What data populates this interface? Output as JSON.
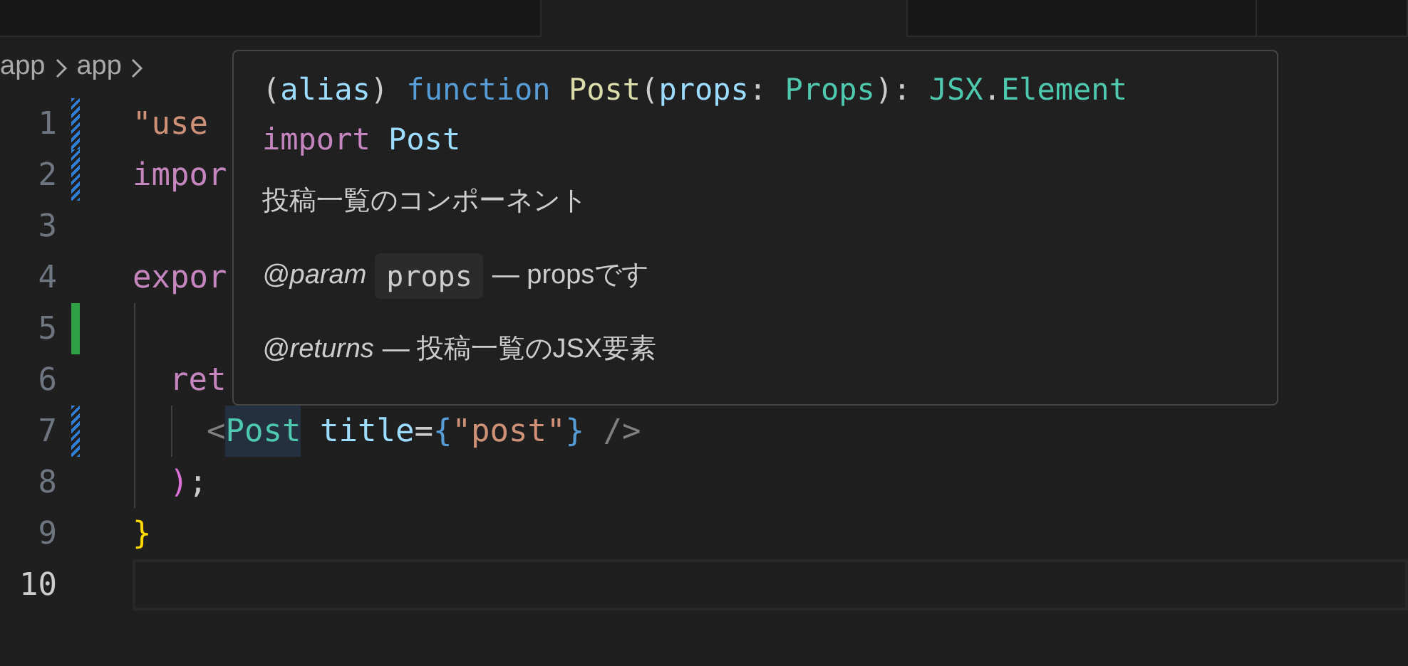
{
  "tabs": [
    {
      "selected": false
    },
    {
      "selected": true
    },
    {
      "selected": false
    },
    {
      "selected": false
    }
  ],
  "breadcrumbs": [
    "app",
    "app"
  ],
  "lines": [
    {
      "number": "1",
      "modified": true,
      "tokens": [
        {
          "text": "\"use",
          "kind": "string"
        }
      ]
    },
    {
      "number": "2",
      "modified": true,
      "tokens": [
        {
          "text": "impor",
          "kind": "keyword"
        }
      ]
    },
    {
      "number": "3"
    },
    {
      "number": "4",
      "tokens": [
        {
          "text": "expor",
          "kind": "keyword"
        }
      ]
    },
    {
      "number": "5",
      "added": true
    },
    {
      "number": "6",
      "tokens": [
        {
          "text": "ret",
          "kind": "keyword"
        }
      ]
    },
    {
      "number": "7",
      "modified": true,
      "tokens": [
        {
          "text": "<",
          "kind": "tag"
        },
        {
          "text": "Post",
          "kind": "component",
          "highlighted": true
        },
        {
          "text": " title",
          "kind": "attribute"
        },
        {
          "text": "=",
          "kind": "plain"
        },
        {
          "text": "{",
          "kind": "brace"
        },
        {
          "text": "\"post\"",
          "kind": "string"
        },
        {
          "text": "}",
          "kind": "brace"
        },
        {
          "text": " />",
          "kind": "tag"
        }
      ]
    },
    {
      "number": "8",
      "tokens": [
        {
          "text": ")",
          "kind": "paren"
        },
        {
          "text": ";",
          "kind": "plain"
        }
      ]
    },
    {
      "number": "9",
      "tokens": [
        {
          "text": "}",
          "kind": "bracket"
        }
      ]
    },
    {
      "number": "10",
      "current": true
    }
  ],
  "hover": {
    "signature": [
      {
        "text": "(",
        "kind": "plain"
      },
      {
        "text": "alias",
        "kind": "variable"
      },
      {
        "text": ") ",
        "kind": "plain"
      },
      {
        "text": "function ",
        "kind": "storage"
      },
      {
        "text": "Post",
        "kind": "function"
      },
      {
        "text": "(",
        "kind": "plain"
      },
      {
        "text": "props",
        "kind": "variable"
      },
      {
        "text": ": ",
        "kind": "plain"
      },
      {
        "text": "Props",
        "kind": "type"
      },
      {
        "text": "): ",
        "kind": "plain"
      },
      {
        "text": "JSX",
        "kind": "type"
      },
      {
        "text": ".",
        "kind": "plain"
      },
      {
        "text": "Element",
        "kind": "type"
      }
    ],
    "import_line": [
      {
        "text": "import ",
        "kind": "keyword"
      },
      {
        "text": "Post",
        "kind": "variable"
      }
    ],
    "description": "投稿一覧のコンポーネント",
    "tags": [
      {
        "tag": "@param",
        "code": "props",
        "text": "— propsです"
      },
      {
        "tag": "@returns",
        "text": "— 投稿一覧のJSX要素"
      }
    ]
  }
}
